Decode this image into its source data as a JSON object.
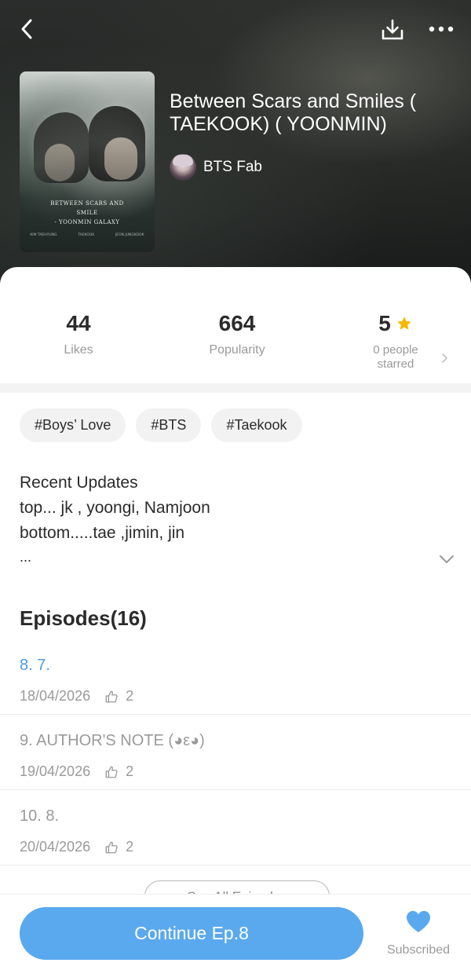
{
  "header": {
    "back_icon": "chevron-left-icon",
    "download_icon": "download-icon",
    "more_icon": "more-horizontal-icon"
  },
  "book": {
    "title": "Between Scars and Smiles ( TAEKOOK) ( YOONMIN)",
    "author": "BTS Fab",
    "cover": {
      "line1": "BETWEEN SCARS AND",
      "line2": "SMILE",
      "line3": "- YOONMIN GALAXY",
      "name_left": "KIM TAEHYUNG",
      "name_mid": "TAEKOOK",
      "name_right": "JEON JUNGKOOK"
    }
  },
  "stats": {
    "likes_value": "44",
    "likes_label": "Likes",
    "popularity_value": "664",
    "popularity_label": "Popularity",
    "rating_value": "5",
    "rating_label": "0 people starred",
    "star_color": "#f5b800"
  },
  "tags": [
    "#Boys’ Love",
    "#BTS",
    "#Taekook"
  ],
  "recent_updates": {
    "heading": "Recent Updates",
    "line1": "top... jk , yoongi, Namjoon",
    "line2": "bottom.....tae ,jimin, jin",
    "line3": "..."
  },
  "episodes": {
    "heading": "Episodes(16)",
    "items": [
      {
        "title": "8. 7.",
        "date": "18/04/2026",
        "likes": "2",
        "current": true
      },
      {
        "title": "9. AUTHOR'S NOTE (◕ε◕)",
        "date": "19/04/2026",
        "likes": "2",
        "current": false
      },
      {
        "title": "10. 8.",
        "date": "20/04/2026",
        "likes": "2",
        "current": false
      }
    ],
    "see_all_label": "See All Episodes"
  },
  "footer": {
    "continue_label": "Continue Ep.8",
    "subscribed_label": "Subscribed",
    "accent_color": "#5aa9ee"
  }
}
